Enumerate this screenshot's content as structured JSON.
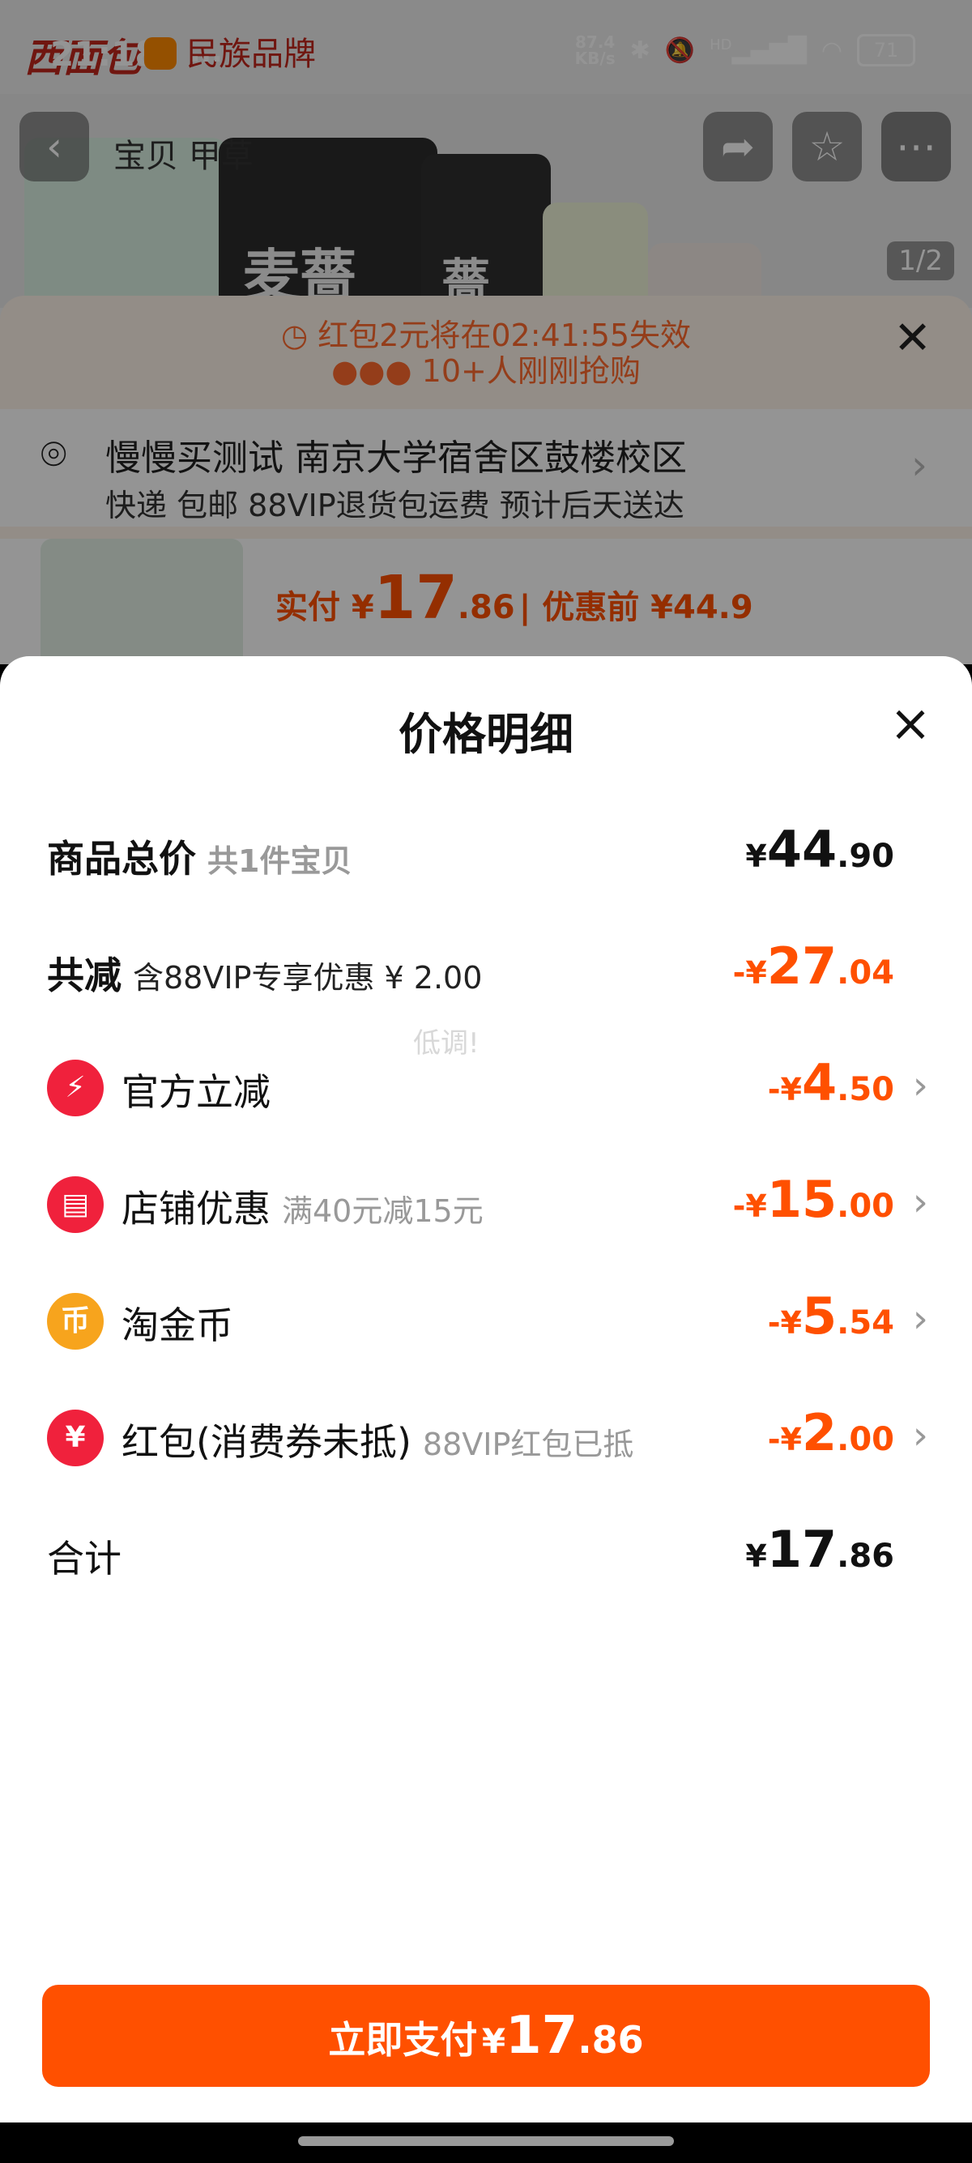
{
  "status_bar": {
    "time": "21:18",
    "dots": "...",
    "brand": "西面包",
    "brand_tag": "民族品牌",
    "net_speed_value": "87.4",
    "net_speed_unit": "KB/s",
    "hd": "HD",
    "battery": "71"
  },
  "background": {
    "tab_label": "宝贝  甲草",
    "pager": "1/2",
    "hero_text_1": "麦薔",
    "hero_text_2": "薔",
    "timer_text": "红包2元将在02:41:55失效",
    "rush_text": "10+人刚刚抢购",
    "address": "慢慢买测试 南京大学宿舍区鼓楼校区",
    "delivery": "快递 包邮 88VIP退货包运费 预计后天送达",
    "pay_label": "实付 ¥",
    "pay_int": "17",
    "pay_dec": ".86",
    "pre_price": "| 优惠前 ¥44.9"
  },
  "sheet": {
    "title": "价格明细",
    "close_icon": "×",
    "watermark": "低调!",
    "rows": [
      {
        "label": "商品总价",
        "sub": "共1件宝贝",
        "cur": "¥",
        "int": "44",
        "dec": ".90"
      },
      {
        "label": "共减",
        "sub": "含88VIP专享优惠 ¥ 2.00",
        "cur": "-¥",
        "int": "27",
        "dec": ".04"
      },
      {
        "label": "官方立减",
        "sub": "",
        "cur": "-¥",
        "int": "4",
        "dec": ".50",
        "icon": "lightning-icon",
        "icon_color": "#f0213c",
        "icon_glyph": "⚡"
      },
      {
        "label": "店铺优惠",
        "sub": "满40元减15元",
        "cur": "-¥",
        "int": "15",
        "dec": ".00",
        "icon": "shop-icon",
        "icon_color": "#f0213c",
        "icon_glyph": "▤"
      },
      {
        "label": "淘金币",
        "sub": "",
        "cur": "-¥",
        "int": "5",
        "dec": ".54",
        "icon": "coin-icon",
        "icon_color": "#f7a41d",
        "icon_glyph": "币"
      },
      {
        "label": "红包(消费券未抵)",
        "sub": "88VIP红包已抵",
        "cur": "-¥",
        "int": "2",
        "dec": ".00",
        "icon": "red-packet-icon",
        "icon_color": "#f0213c",
        "icon_glyph": "¥"
      },
      {
        "label": "合计",
        "sub": "",
        "cur": "¥",
        "int": "17",
        "dec": ".86"
      }
    ],
    "pay_button": {
      "label": "立即支付",
      "cur": "¥",
      "int": "17",
      "dec": ".86"
    }
  },
  "colors": {
    "accent": "#ff5000",
    "icon_red": "#f0213c",
    "icon_gold": "#f7a41d"
  }
}
